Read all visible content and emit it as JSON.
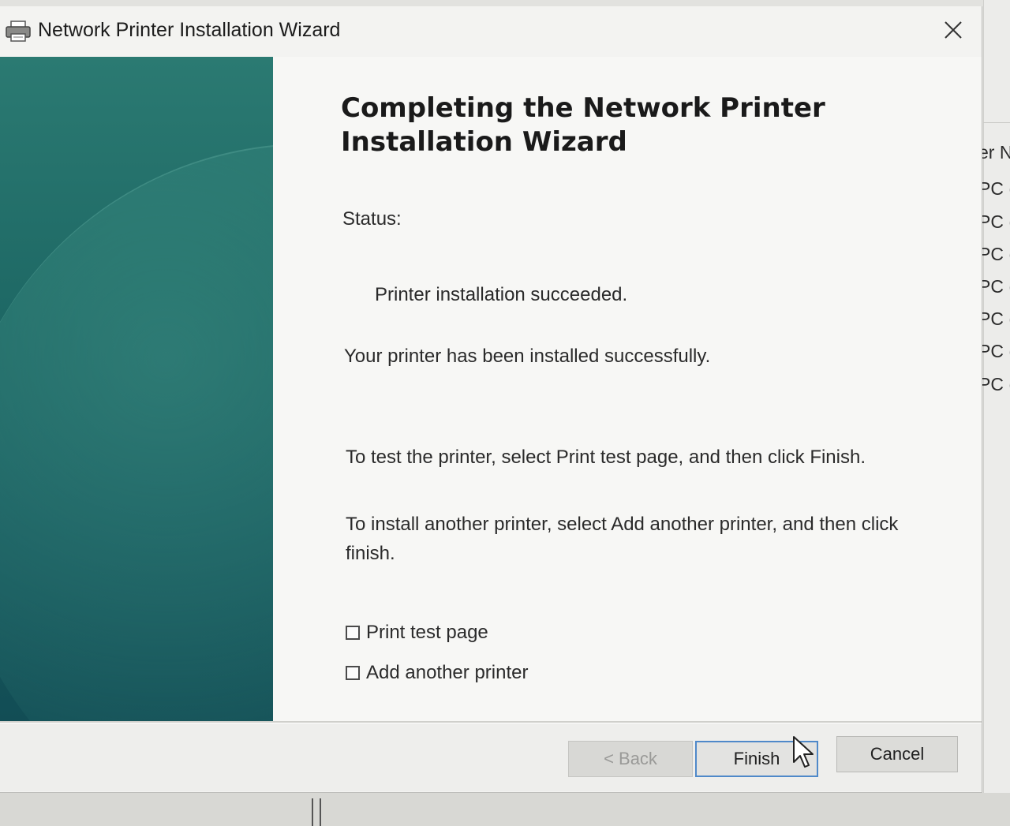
{
  "background_app": {
    "column_header_fragment": "er N",
    "row_fragments": [
      "PC (I",
      "PC (I",
      "PC (I",
      "PC (I",
      "PC (I",
      "PC (I",
      "PC (I"
    ]
  },
  "window": {
    "title": "Network Printer Installation Wizard",
    "icon": "printer-icon",
    "close_icon": "close-icon"
  },
  "wizard": {
    "heading": "Completing the Network Printer Installation Wizard",
    "status_label": "Status:",
    "status_value": "Printer installation succeeded.",
    "success_message": "Your printer has been installed successfully.",
    "test_instruction": "To test the printer, select Print test page, and then click Finish.",
    "another_instruction": "To install another printer, select Add another printer, and then click finish.",
    "checkboxes": [
      {
        "label": "Print test page",
        "checked": false
      },
      {
        "label": "Add another printer",
        "checked": false
      }
    ]
  },
  "footer": {
    "back_label": "< Back",
    "back_enabled": false,
    "finish_label": "Finish",
    "cancel_label": "Cancel"
  },
  "colors": {
    "side_panel": "#1f6a66",
    "finish_border": "#4f89c9"
  }
}
